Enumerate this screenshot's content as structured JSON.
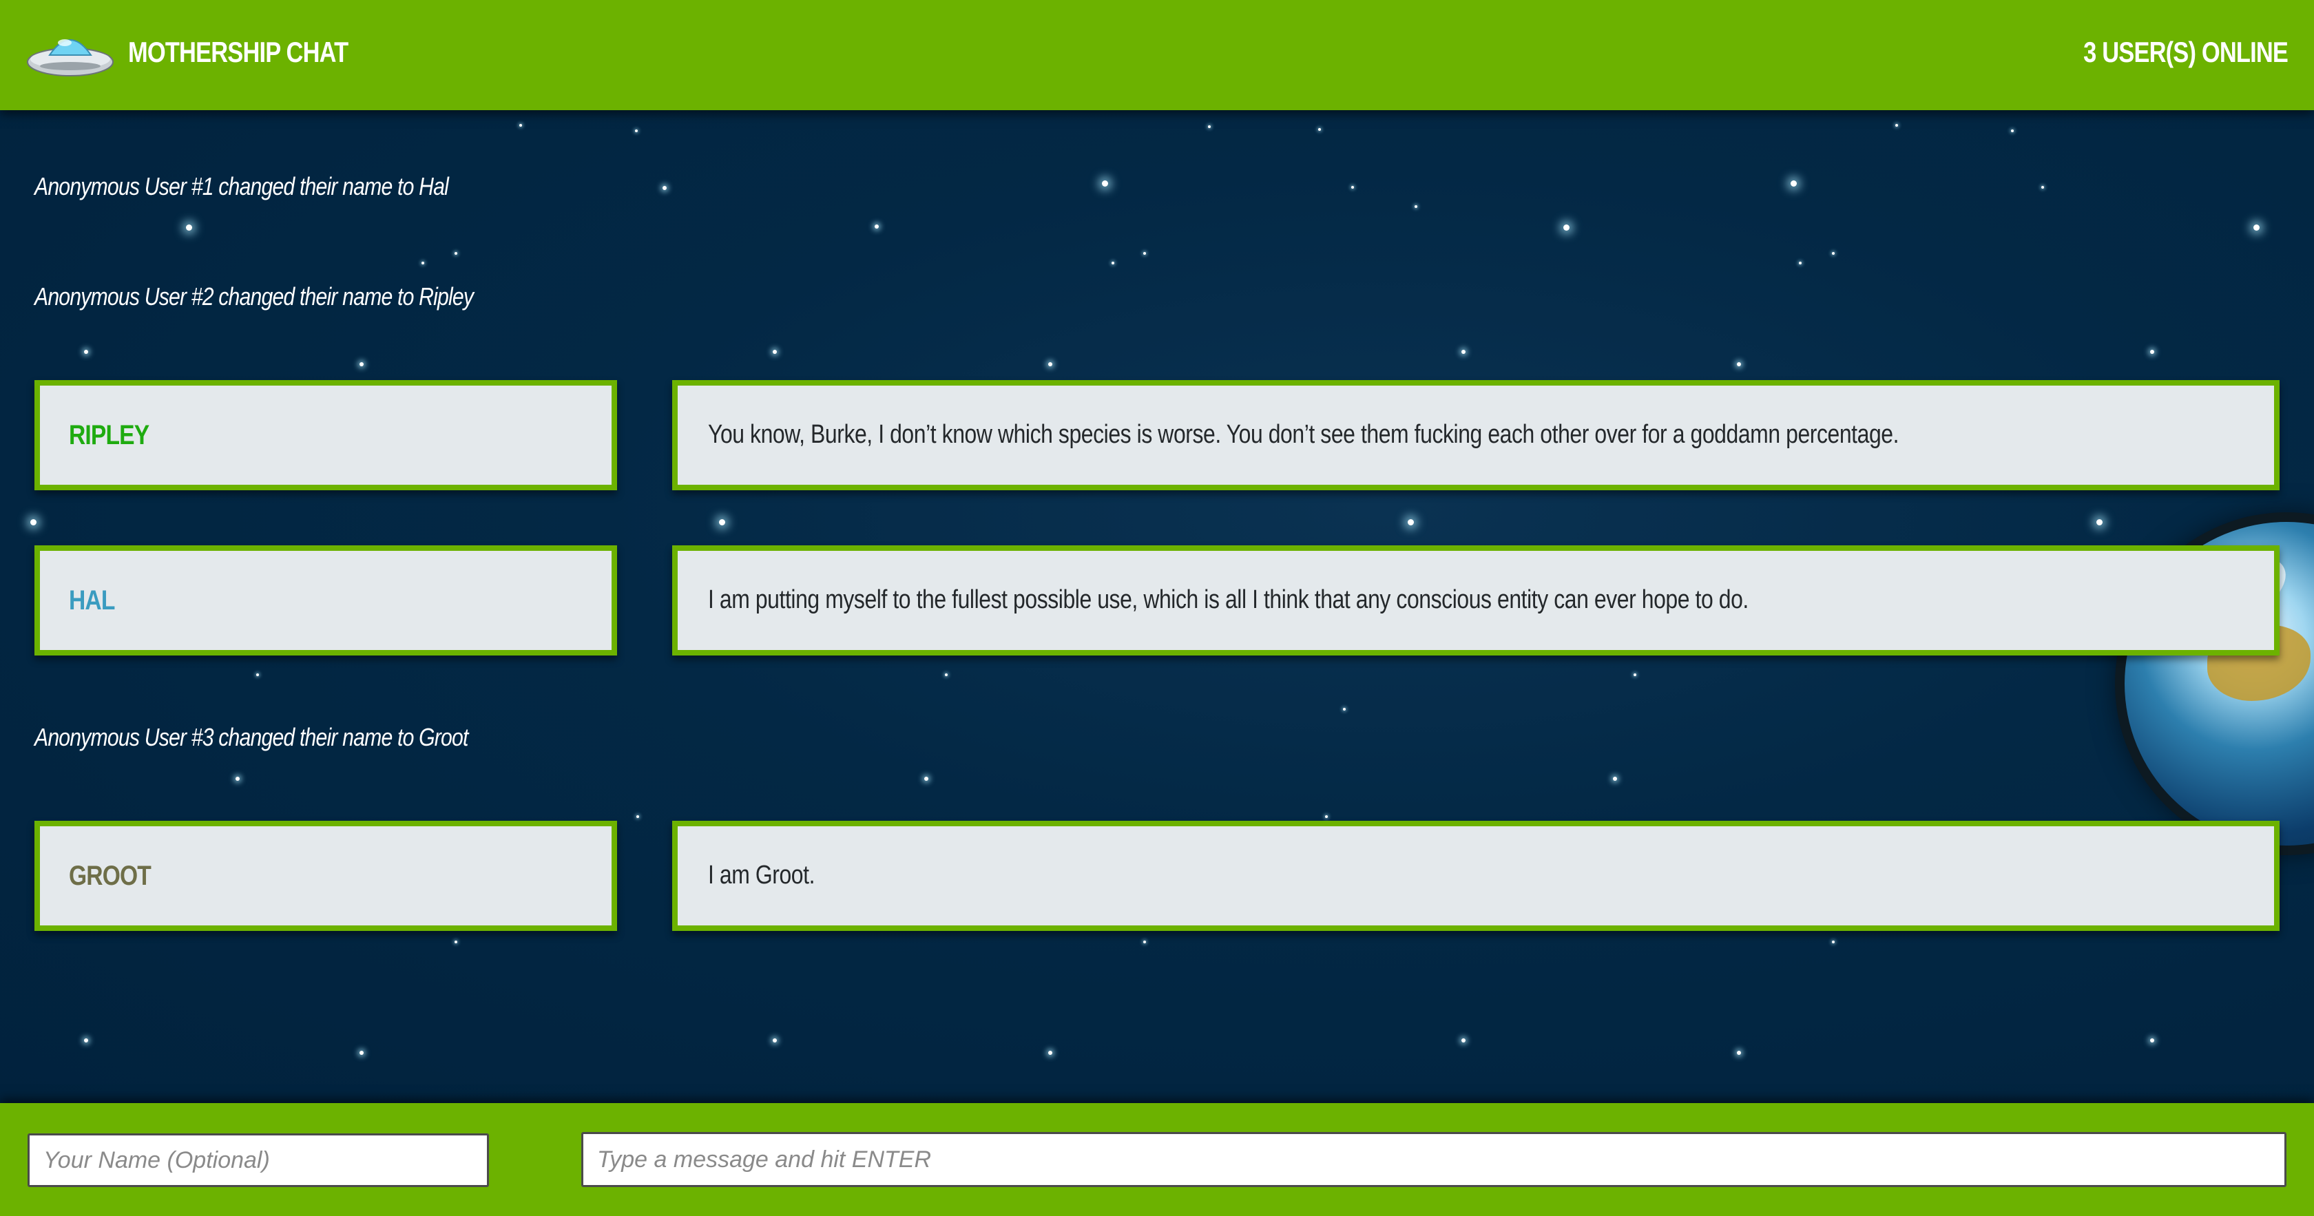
{
  "header": {
    "title": "MOTHERSHIP CHAT",
    "online": "3 USER(S) ONLINE",
    "logo_icon": "ufo-icon",
    "background_color": "#6cb200"
  },
  "feed": {
    "notices": [
      {
        "text": "Anonymous User #1 changed their name to Hal"
      },
      {
        "text": "Anonymous User #2 changed their name to Ripley"
      },
      {
        "text": "Anonymous User #3 changed their name to Groot"
      }
    ],
    "messages": [
      {
        "user": "RIPLEY",
        "user_color": "#1fab10",
        "text": "You know, Burke, I don’t know which species is worse. You don’t see them fucking each other over for a goddamn percentage."
      },
      {
        "user": "HAL",
        "user_color": "#3a9cc0",
        "text": "I am putting myself to the fullest possible use, which is all I think that any conscious entity can ever hope to do."
      },
      {
        "user": "GROOT",
        "user_color": "#6e6e48",
        "text": "I am Groot."
      }
    ]
  },
  "footer": {
    "name_placeholder": "Your Name (Optional)",
    "name_value": "",
    "message_placeholder": "Type a message and hit ENTER",
    "message_value": ""
  },
  "theme": {
    "accent": "#6cb200",
    "space_background": "#00223d",
    "bubble_background": "#e4e9ec"
  }
}
